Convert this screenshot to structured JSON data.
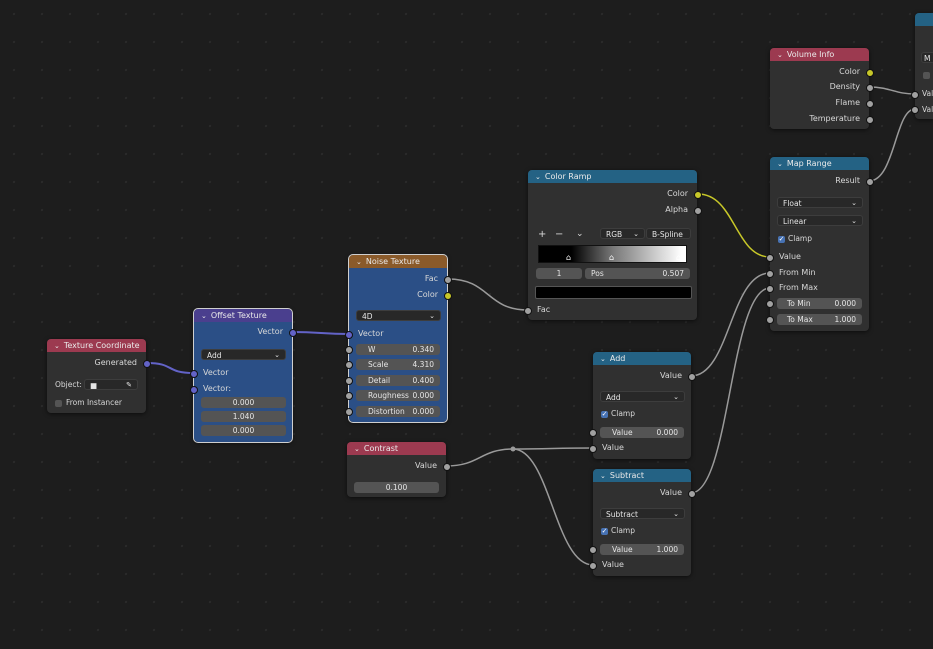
{
  "texture_coordinate": {
    "title": "Texture Coordinate",
    "out_generated": "Generated",
    "object_label": "Object:",
    "from_instancer": "From Instancer"
  },
  "offset_texture": {
    "title": "Offset Texture",
    "out_vector": "Vector",
    "mode": "Add",
    "in_vector": "Vector",
    "in_vector2": "Vector:",
    "values": [
      "0.000",
      "1.040",
      "0.000"
    ]
  },
  "noise_texture": {
    "title": "Noise Texture",
    "out_fac": "Fac",
    "out_color": "Color",
    "dimensions": "4D",
    "in_vector": "Vector",
    "fields": [
      {
        "label": "W",
        "value": "0.340"
      },
      {
        "label": "Scale",
        "value": "4.310"
      },
      {
        "label": "Detail",
        "value": "0.400"
      },
      {
        "label": "Roughness",
        "value": "0.000"
      },
      {
        "label": "Distortion",
        "value": "0.000"
      }
    ]
  },
  "color_ramp": {
    "title": "Color Ramp",
    "out_color": "Color",
    "out_alpha": "Alpha",
    "add_btn": "+",
    "remove_btn": "−",
    "color_mode": "RGB",
    "interpolation": "B-Spline",
    "stop_index": "1",
    "pos_label": "Pos",
    "pos_value": "0.507",
    "in_fac": "Fac"
  },
  "contrast": {
    "title": "Contrast",
    "out_value": "Value",
    "value": "0.100"
  },
  "add": {
    "title": "Add",
    "out_value": "Value",
    "operation": "Add",
    "clamp": "Clamp",
    "value_label": "Value",
    "value": "0.000",
    "in_value": "Value"
  },
  "subtract": {
    "title": "Subtract",
    "out_value": "Value",
    "operation": "Subtract",
    "clamp": "Clamp",
    "value_label": "Value",
    "value": "1.000",
    "in_value": "Value"
  },
  "volume_info": {
    "title": "Volume Info",
    "outputs": [
      "Color",
      "Density",
      "Flame",
      "Temperature"
    ]
  },
  "map_range": {
    "title": "Map Range",
    "out_result": "Result",
    "data_type": "Float",
    "interpolation": "Linear",
    "clamp": "Clamp",
    "in_value": "Value",
    "in_from_min": "From Min",
    "in_from_max": "From Max",
    "to_min_label": "To Min",
    "to_min": "0.000",
    "to_max_label": "To Max",
    "to_max": "1.000"
  },
  "partial_node": {
    "field": "M",
    "in1": "Valu",
    "in2": "Valu"
  },
  "colors": {
    "background": "#1d1d1d",
    "node_body": "#303030",
    "selected_body": "#2b4f86",
    "header_input": "#9c3a50",
    "header_vector": "#4a3f8e",
    "header_texture": "#8a5a2a",
    "header_converter": "#246284",
    "socket_gray": "#a1a1a1",
    "socket_yellow": "#c7c729",
    "socket_purple": "#6363c7"
  }
}
